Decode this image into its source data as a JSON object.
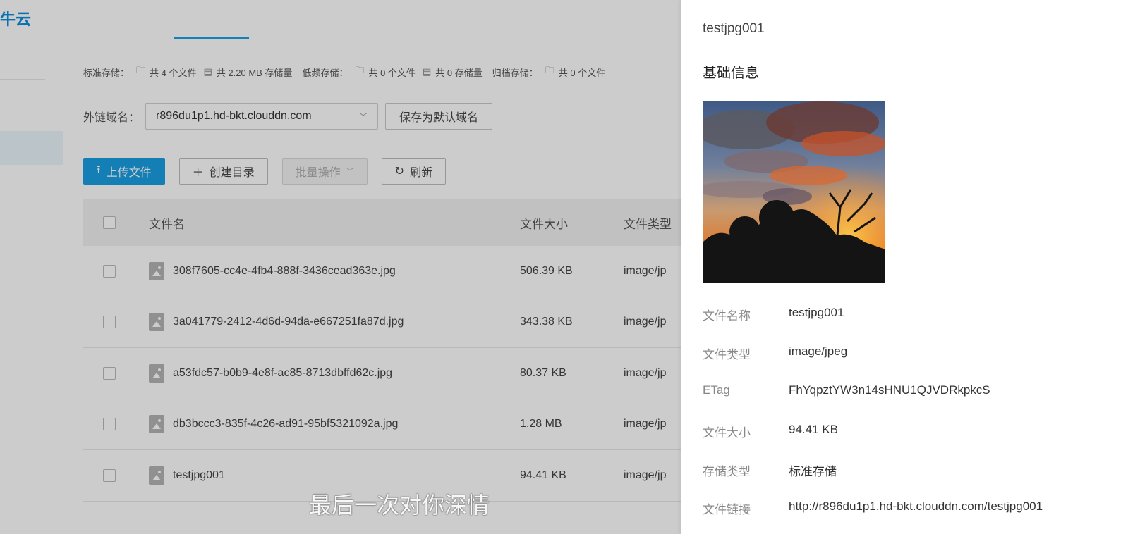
{
  "brand": {
    "logo_text": "牛云"
  },
  "stats": {
    "standard_label": "标准存储：",
    "standard_files": "共 4 个文件",
    "standard_size": "共 2.20 MB 存储量",
    "infrequent_label": "低频存储：",
    "infrequent_files": "共 0 个文件",
    "infrequent_size": "共 0 存储量",
    "archive_label": "归档存储：",
    "archive_files": "共 0 个文件"
  },
  "domain": {
    "label": "外链域名：",
    "value": "r896du1p1.hd-bkt.clouddn.com",
    "save_default_label": "保存为默认域名"
  },
  "toolbar": {
    "upload_label": "上传文件",
    "create_dir_label": "创建目录",
    "batch_label": "批量操作",
    "refresh_label": "刷新"
  },
  "table": {
    "columns": {
      "name": "文件名",
      "size": "文件大小",
      "type": "文件类型"
    },
    "rows": [
      {
        "name": "308f7605-cc4e-4fb4-888f-3436cead363e.jpg",
        "size": "506.39 KB",
        "type": "image/jp"
      },
      {
        "name": "3a041779-2412-4d6d-94da-e667251fa87d.jpg",
        "size": "343.38 KB",
        "type": "image/jp"
      },
      {
        "name": "a53fdc57-b0b9-4e8f-ac85-8713dbffd62c.jpg",
        "size": "80.37 KB",
        "type": "image/jp"
      },
      {
        "name": "db3bccc3-835f-4c26-ad91-95bf5321092a.jpg",
        "size": "1.28 MB",
        "type": "image/jp"
      },
      {
        "name": "testjpg001",
        "size": "94.41 KB",
        "type": "image/jp"
      }
    ]
  },
  "subtitle": "最后一次对你深情",
  "drawer": {
    "title": "testjpg001",
    "section_title": "基础信息",
    "info": {
      "name_label": "文件名称",
      "name_value": "testjpg001",
      "type_label": "文件类型",
      "type_value": "image/jpeg",
      "etag_label": "ETag",
      "etag_value": "FhYqpztYW3n14sHNU1QJVDRkpkcS",
      "size_label": "文件大小",
      "size_value": "94.41 KB",
      "storage_label": "存储类型",
      "storage_value": "标准存储",
      "link_label": "文件链接",
      "link_value": "http://r896du1p1.hd-bkt.clouddn.com/testjpg001"
    }
  },
  "colors": {
    "primary": "#1a9fe3",
    "overlay": "rgba(0,0,0,0.2)"
  }
}
